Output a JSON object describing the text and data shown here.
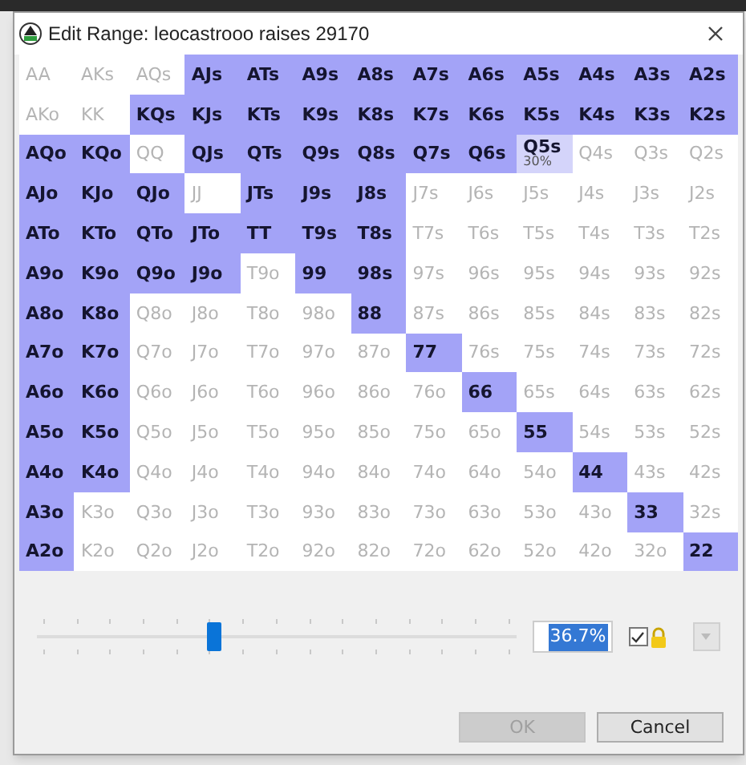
{
  "window": {
    "title": "Edit Range: leocastrooo raises 29170"
  },
  "grid": [
    [
      {
        "label": "AA",
        "selected": false
      },
      {
        "label": "AKs",
        "selected": false
      },
      {
        "label": "AQs",
        "selected": false
      },
      {
        "label": "AJs",
        "selected": true
      },
      {
        "label": "ATs",
        "selected": true
      },
      {
        "label": "A9s",
        "selected": true
      },
      {
        "label": "A8s",
        "selected": true
      },
      {
        "label": "A7s",
        "selected": true
      },
      {
        "label": "A6s",
        "selected": true
      },
      {
        "label": "A5s",
        "selected": true
      },
      {
        "label": "A4s",
        "selected": true
      },
      {
        "label": "A3s",
        "selected": true
      },
      {
        "label": "A2s",
        "selected": true
      }
    ],
    [
      {
        "label": "AKo",
        "selected": false
      },
      {
        "label": "KK",
        "selected": false
      },
      {
        "label": "KQs",
        "selected": true
      },
      {
        "label": "KJs",
        "selected": true
      },
      {
        "label": "KTs",
        "selected": true
      },
      {
        "label": "K9s",
        "selected": true
      },
      {
        "label": "K8s",
        "selected": true
      },
      {
        "label": "K7s",
        "selected": true
      },
      {
        "label": "K6s",
        "selected": true
      },
      {
        "label": "K5s",
        "selected": true
      },
      {
        "label": "K4s",
        "selected": true
      },
      {
        "label": "K3s",
        "selected": true
      },
      {
        "label": "K2s",
        "selected": true
      }
    ],
    [
      {
        "label": "AQo",
        "selected": true
      },
      {
        "label": "KQo",
        "selected": true
      },
      {
        "label": "QQ",
        "selected": false
      },
      {
        "label": "QJs",
        "selected": true
      },
      {
        "label": "QTs",
        "selected": true
      },
      {
        "label": "Q9s",
        "selected": true
      },
      {
        "label": "Q8s",
        "selected": true
      },
      {
        "label": "Q7s",
        "selected": true
      },
      {
        "label": "Q6s",
        "selected": true
      },
      {
        "label": "Q5s",
        "selected": true,
        "partial": true,
        "frequency": "30%"
      },
      {
        "label": "Q4s",
        "selected": false
      },
      {
        "label": "Q3s",
        "selected": false
      },
      {
        "label": "Q2s",
        "selected": false
      }
    ],
    [
      {
        "label": "AJo",
        "selected": true
      },
      {
        "label": "KJo",
        "selected": true
      },
      {
        "label": "QJo",
        "selected": true
      },
      {
        "label": "JJ",
        "selected": false
      },
      {
        "label": "JTs",
        "selected": true
      },
      {
        "label": "J9s",
        "selected": true
      },
      {
        "label": "J8s",
        "selected": true
      },
      {
        "label": "J7s",
        "selected": false
      },
      {
        "label": "J6s",
        "selected": false
      },
      {
        "label": "J5s",
        "selected": false
      },
      {
        "label": "J4s",
        "selected": false
      },
      {
        "label": "J3s",
        "selected": false
      },
      {
        "label": "J2s",
        "selected": false
      }
    ],
    [
      {
        "label": "ATo",
        "selected": true
      },
      {
        "label": "KTo",
        "selected": true
      },
      {
        "label": "QTo",
        "selected": true
      },
      {
        "label": "JTo",
        "selected": true
      },
      {
        "label": "TT",
        "selected": true
      },
      {
        "label": "T9s",
        "selected": true
      },
      {
        "label": "T8s",
        "selected": true
      },
      {
        "label": "T7s",
        "selected": false
      },
      {
        "label": "T6s",
        "selected": false
      },
      {
        "label": "T5s",
        "selected": false
      },
      {
        "label": "T4s",
        "selected": false
      },
      {
        "label": "T3s",
        "selected": false
      },
      {
        "label": "T2s",
        "selected": false
      }
    ],
    [
      {
        "label": "A9o",
        "selected": true
      },
      {
        "label": "K9o",
        "selected": true
      },
      {
        "label": "Q9o",
        "selected": true
      },
      {
        "label": "J9o",
        "selected": true
      },
      {
        "label": "T9o",
        "selected": false
      },
      {
        "label": "99",
        "selected": true
      },
      {
        "label": "98s",
        "selected": true
      },
      {
        "label": "97s",
        "selected": false
      },
      {
        "label": "96s",
        "selected": false
      },
      {
        "label": "95s",
        "selected": false
      },
      {
        "label": "94s",
        "selected": false
      },
      {
        "label": "93s",
        "selected": false
      },
      {
        "label": "92s",
        "selected": false
      }
    ],
    [
      {
        "label": "A8o",
        "selected": true
      },
      {
        "label": "K8o",
        "selected": true
      },
      {
        "label": "Q8o",
        "selected": false
      },
      {
        "label": "J8o",
        "selected": false
      },
      {
        "label": "T8o",
        "selected": false
      },
      {
        "label": "98o",
        "selected": false
      },
      {
        "label": "88",
        "selected": true
      },
      {
        "label": "87s",
        "selected": false
      },
      {
        "label": "86s",
        "selected": false
      },
      {
        "label": "85s",
        "selected": false
      },
      {
        "label": "84s",
        "selected": false
      },
      {
        "label": "83s",
        "selected": false
      },
      {
        "label": "82s",
        "selected": false
      }
    ],
    [
      {
        "label": "A7o",
        "selected": true
      },
      {
        "label": "K7o",
        "selected": true
      },
      {
        "label": "Q7o",
        "selected": false
      },
      {
        "label": "J7o",
        "selected": false
      },
      {
        "label": "T7o",
        "selected": false
      },
      {
        "label": "97o",
        "selected": false
      },
      {
        "label": "87o",
        "selected": false
      },
      {
        "label": "77",
        "selected": true
      },
      {
        "label": "76s",
        "selected": false
      },
      {
        "label": "75s",
        "selected": false
      },
      {
        "label": "74s",
        "selected": false
      },
      {
        "label": "73s",
        "selected": false
      },
      {
        "label": "72s",
        "selected": false
      }
    ],
    [
      {
        "label": "A6o",
        "selected": true
      },
      {
        "label": "K6o",
        "selected": true
      },
      {
        "label": "Q6o",
        "selected": false
      },
      {
        "label": "J6o",
        "selected": false
      },
      {
        "label": "T6o",
        "selected": false
      },
      {
        "label": "96o",
        "selected": false
      },
      {
        "label": "86o",
        "selected": false
      },
      {
        "label": "76o",
        "selected": false
      },
      {
        "label": "66",
        "selected": true
      },
      {
        "label": "65s",
        "selected": false
      },
      {
        "label": "64s",
        "selected": false
      },
      {
        "label": "63s",
        "selected": false
      },
      {
        "label": "62s",
        "selected": false
      }
    ],
    [
      {
        "label": "A5o",
        "selected": true
      },
      {
        "label": "K5o",
        "selected": true
      },
      {
        "label": "Q5o",
        "selected": false
      },
      {
        "label": "J5o",
        "selected": false
      },
      {
        "label": "T5o",
        "selected": false
      },
      {
        "label": "95o",
        "selected": false
      },
      {
        "label": "85o",
        "selected": false
      },
      {
        "label": "75o",
        "selected": false
      },
      {
        "label": "65o",
        "selected": false
      },
      {
        "label": "55",
        "selected": true
      },
      {
        "label": "54s",
        "selected": false
      },
      {
        "label": "53s",
        "selected": false
      },
      {
        "label": "52s",
        "selected": false
      }
    ],
    [
      {
        "label": "A4o",
        "selected": true
      },
      {
        "label": "K4o",
        "selected": true
      },
      {
        "label": "Q4o",
        "selected": false
      },
      {
        "label": "J4o",
        "selected": false
      },
      {
        "label": "T4o",
        "selected": false
      },
      {
        "label": "94o",
        "selected": false
      },
      {
        "label": "84o",
        "selected": false
      },
      {
        "label": "74o",
        "selected": false
      },
      {
        "label": "64o",
        "selected": false
      },
      {
        "label": "54o",
        "selected": false
      },
      {
        "label": "44",
        "selected": true
      },
      {
        "label": "43s",
        "selected": false
      },
      {
        "label": "42s",
        "selected": false
      }
    ],
    [
      {
        "label": "A3o",
        "selected": true
      },
      {
        "label": "K3o",
        "selected": false
      },
      {
        "label": "Q3o",
        "selected": false
      },
      {
        "label": "J3o",
        "selected": false
      },
      {
        "label": "T3o",
        "selected": false
      },
      {
        "label": "93o",
        "selected": false
      },
      {
        "label": "83o",
        "selected": false
      },
      {
        "label": "73o",
        "selected": false
      },
      {
        "label": "63o",
        "selected": false
      },
      {
        "label": "53o",
        "selected": false
      },
      {
        "label": "43o",
        "selected": false
      },
      {
        "label": "33",
        "selected": true
      },
      {
        "label": "32s",
        "selected": false
      }
    ],
    [
      {
        "label": "A2o",
        "selected": true
      },
      {
        "label": "K2o",
        "selected": false
      },
      {
        "label": "Q2o",
        "selected": false
      },
      {
        "label": "J2o",
        "selected": false
      },
      {
        "label": "T2o",
        "selected": false
      },
      {
        "label": "92o",
        "selected": false
      },
      {
        "label": "82o",
        "selected": false
      },
      {
        "label": "72o",
        "selected": false
      },
      {
        "label": "62o",
        "selected": false
      },
      {
        "label": "52o",
        "selected": false
      },
      {
        "label": "42o",
        "selected": false
      },
      {
        "label": "32o",
        "selected": false
      },
      {
        "label": "22",
        "selected": true
      }
    ]
  ],
  "slider": {
    "level": 0.367
  },
  "percent_field": {
    "value": "36.7%"
  },
  "lock_checkbox": {
    "checked": true
  },
  "buttons": [
    {
      "label": "OK",
      "disabled": true
    },
    {
      "label": "Cancel",
      "disabled": false
    }
  ]
}
